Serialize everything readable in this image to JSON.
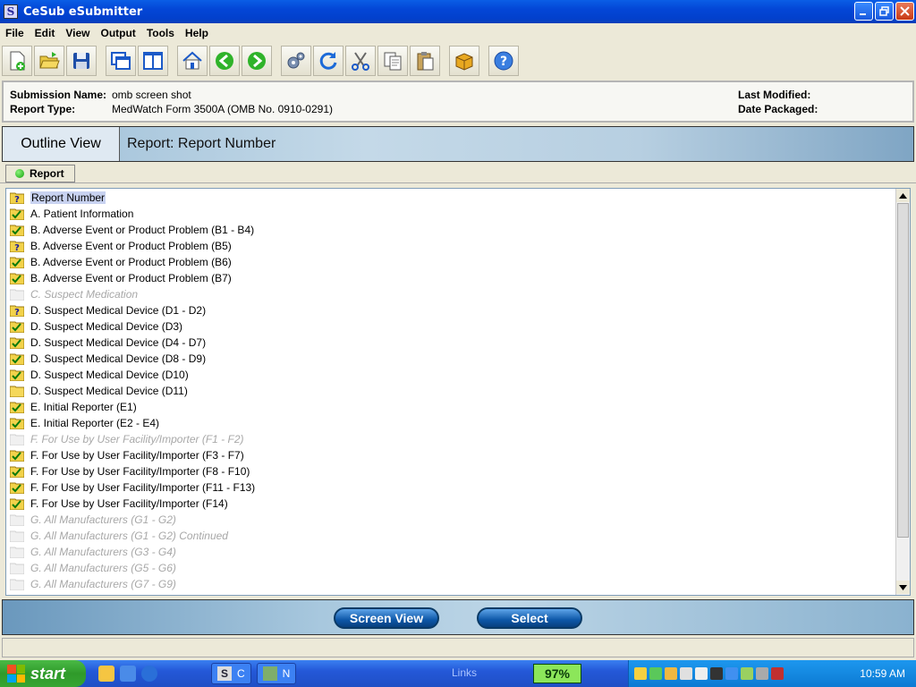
{
  "window": {
    "title": "CeSub eSubmitter",
    "app_icon_letter": "S"
  },
  "menu": [
    "File",
    "Edit",
    "View",
    "Output",
    "Tools",
    "Help"
  ],
  "toolbar_icons": [
    "new-document-icon",
    "open-folder-icon",
    "save-icon",
    "cascade-windows-icon",
    "split-view-icon",
    "home-icon",
    "back-arrow-icon",
    "forward-arrow-icon",
    "settings-gears-icon",
    "refresh-icon",
    "cut-icon",
    "copy-icon",
    "paste-icon",
    "package-icon",
    "help-icon"
  ],
  "info": {
    "submission_label": "Submission Name:",
    "submission_value": "omb screen shot",
    "report_type_label": "Report Type:",
    "report_type_value": "MedWatch Form 3500A (OMB No. 0910-0291)",
    "last_modified_label": "Last Modified:",
    "date_packaged_label": "Date Packaged:"
  },
  "outline": {
    "tab_label": "Outline View",
    "title": "Report: Report Number"
  },
  "report_tab": {
    "label": "Report"
  },
  "tree": [
    {
      "label": "Report Number",
      "status": "question",
      "selected": true
    },
    {
      "label": "A. Patient Information",
      "status": "check"
    },
    {
      "label": "B. Adverse Event or Product Problem (B1 - B4)",
      "status": "check"
    },
    {
      "label": "B. Adverse Event or Product Problem (B5)",
      "status": "question"
    },
    {
      "label": "B. Adverse Event or Product Problem (B6)",
      "status": "check"
    },
    {
      "label": "B. Adverse Event or Product Problem (B7)",
      "status": "check"
    },
    {
      "label": "C. Suspect Medication",
      "status": "disabled"
    },
    {
      "label": "D. Suspect Medical Device (D1 - D2)",
      "status": "question"
    },
    {
      "label": "D. Suspect Medical Device (D3)",
      "status": "check"
    },
    {
      "label": "D. Suspect Medical Device (D4 - D7)",
      "status": "check"
    },
    {
      "label": "D. Suspect Medical Device (D8 - D9)",
      "status": "check"
    },
    {
      "label": "D. Suspect Medical Device (D10)",
      "status": "check"
    },
    {
      "label": "D. Suspect Medical Device (D11)",
      "status": "empty"
    },
    {
      "label": "E. Initial Reporter (E1)",
      "status": "check"
    },
    {
      "label": "E. Initial Reporter (E2 - E4)",
      "status": "check"
    },
    {
      "label": "F. For Use by User Facility/Importer (F1 - F2)",
      "status": "disabled"
    },
    {
      "label": "F. For Use by User Facility/Importer (F3 - F7)",
      "status": "check"
    },
    {
      "label": "F. For Use by User Facility/Importer (F8 - F10)",
      "status": "check"
    },
    {
      "label": "F. For Use by User Facility/Importer (F11 - F13)",
      "status": "check"
    },
    {
      "label": "F. For Use by User Facility/Importer (F14)",
      "status": "check"
    },
    {
      "label": "G. All Manufacturers (G1 - G2)",
      "status": "disabled"
    },
    {
      "label": "G. All Manufacturers (G1 - G2) Continued",
      "status": "disabled"
    },
    {
      "label": "G. All Manufacturers (G3 - G4)",
      "status": "disabled"
    },
    {
      "label": "G. All Manufacturers (G5 - G6)",
      "status": "disabled"
    },
    {
      "label": "G. All Manufacturers (G7 - G9)",
      "status": "disabled"
    }
  ],
  "buttons": {
    "screen_view": "Screen View",
    "select": "Select"
  },
  "taskbar": {
    "start": "start",
    "task1": "C",
    "task2": "N",
    "links": "Links",
    "battery": "97%",
    "clock": "10:59 AM"
  }
}
